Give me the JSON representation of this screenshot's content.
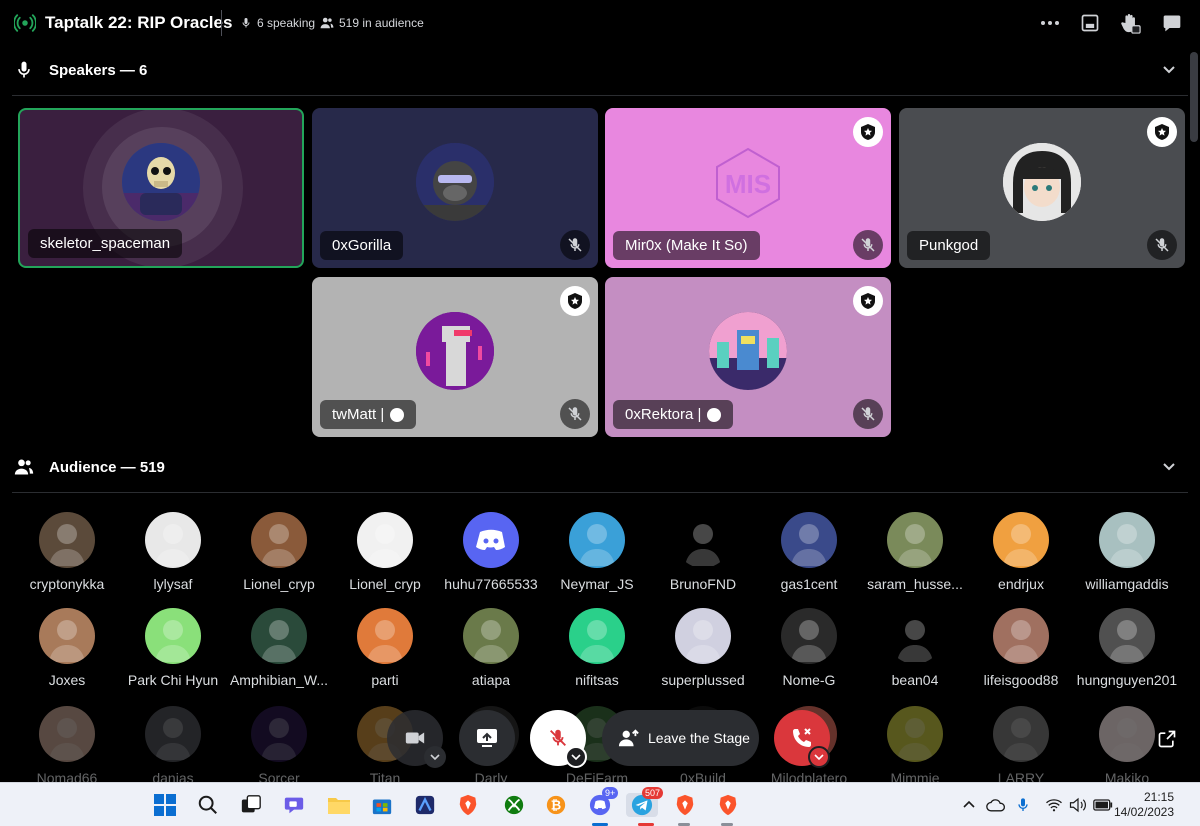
{
  "header": {
    "title": "Taptalk 22: RIP Oracles",
    "speaking": "6 speaking",
    "audience": "519 in audience"
  },
  "speakers_section": {
    "title": "Speakers — 6"
  },
  "audience_section": {
    "title": "Audience — 519"
  },
  "speakers": [
    {
      "name": "skeletor_spaceman",
      "bg": "#3a1f3f",
      "active": true
    },
    {
      "name": "0xGorilla",
      "bg": "#27294a"
    },
    {
      "name": "Mir0x (Make It So)",
      "bg": "#e887df",
      "badge": true
    },
    {
      "name": "Punkgod",
      "bg": "#4a4c50",
      "badge": true
    },
    {
      "name": "twMatt |",
      "bg": "#b3b3b3",
      "badge": true,
      "status_dot": true
    },
    {
      "name": "0xRektora |",
      "bg": "#c48ec2",
      "badge": true,
      "status_dot": true
    }
  ],
  "audience": [
    {
      "name": "cryptonykka",
      "color": "#5b4a3a"
    },
    {
      "name": "lylysaf",
      "color": "#e8e8e8"
    },
    {
      "name": "Lionel_cryp",
      "color": "#8a5a3a"
    },
    {
      "name": "Lionel_cryp",
      "color": "#f1f1f1"
    },
    {
      "name": "huhu77665533",
      "color": "#5865f2"
    },
    {
      "name": "Neymar_JS",
      "color": "#3aa0d8"
    },
    {
      "name": "BrunoFND",
      "color": "#000000"
    },
    {
      "name": "gas1cent",
      "color": "#3a4a8a"
    },
    {
      "name": "saram_husse...",
      "color": "#7a8a5a"
    },
    {
      "name": "endrjux",
      "color": "#f0a040"
    },
    {
      "name": "williamgaddis",
      "color": "#a8c0c0"
    },
    {
      "name": "Joxes",
      "color": "#a87a5a"
    },
    {
      "name": "Park Chi Hyun",
      "color": "#8ae07a"
    },
    {
      "name": "Amphibian_W...",
      "color": "#2a4a3a"
    },
    {
      "name": "parti",
      "color": "#e07a3a"
    },
    {
      "name": "atiapa",
      "color": "#6a7a4a"
    },
    {
      "name": "nifitsas",
      "color": "#2ad08a"
    },
    {
      "name": "superplussed",
      "color": "#d0d0e0"
    },
    {
      "name": "Nome-G",
      "color": "#2a2a2a"
    },
    {
      "name": "bean04",
      "color": "#000000"
    },
    {
      "name": "lifeisgood88",
      "color": "#a07060"
    },
    {
      "name": "hungnguyen201",
      "color": "#505050"
    }
  ],
  "audience_partial": [
    {
      "name": "Nomad66",
      "color": "#c0a090"
    },
    {
      "name": "danias",
      "color": "#4e5058"
    },
    {
      "name": "Sorcer",
      "color": "#2a1a4a"
    },
    {
      "name": "Titan",
      "color": "#c08a3a"
    },
    {
      "name": "Darly",
      "color": "#303030"
    },
    {
      "name": "DeFiFarm",
      "color": "#3a6a3a"
    },
    {
      "name": "0xBuild",
      "color": "#1a1a1a"
    },
    {
      "name": "Milodplatero",
      "color": "#e07060"
    },
    {
      "name": "Mimmie",
      "color": "#c0c040"
    },
    {
      "name": "LARRY",
      "color": "#7a7a7a"
    },
    {
      "name": "Makiko",
      "color": "#f0e0e0"
    }
  ],
  "controls": {
    "leave_label": "Leave the Stage"
  },
  "taskbar": {
    "time": "21:15",
    "date": "14/02/2023",
    "discord_badge": "9+",
    "telegram_badge": "507"
  },
  "colors": {
    "accent_green": "#23a55a",
    "danger_red": "#da373c",
    "blurple": "#5865f2"
  }
}
